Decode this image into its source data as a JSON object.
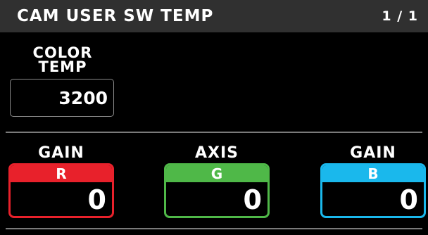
{
  "header": {
    "title": "CAM USER SW TEMP",
    "page": "1 / 1"
  },
  "color_temp": {
    "label_line1": "COLOR",
    "label_line2": "TEMP",
    "value": "3200"
  },
  "params": [
    {
      "label": "GAIN",
      "channel": "R",
      "value": "0",
      "color": "#e8212b"
    },
    {
      "label": "AXIS",
      "channel": "G",
      "value": "0",
      "color": "#4fb848"
    },
    {
      "label": "GAIN",
      "channel": "B",
      "value": "0",
      "color": "#1ab8ec"
    }
  ],
  "colors": {
    "background": "#000000",
    "header_bg": "#303030",
    "text": "#ffffff",
    "divider": "#7a7a7a"
  }
}
